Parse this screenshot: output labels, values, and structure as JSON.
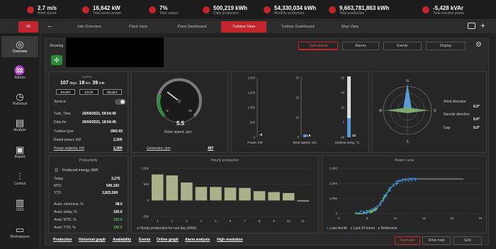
{
  "kpis": [
    {
      "value": "2.7 m/s",
      "label": "Wind speed"
    },
    {
      "value": "16,642 kW",
      "label": "Total active power"
    },
    {
      "value": "7%",
      "label": "Total output"
    },
    {
      "value": "500,219 kWh",
      "label": "Daily production"
    },
    {
      "value": "54,330,034 kWh",
      "label": "Monthly production"
    },
    {
      "value": "9,663,781,863 kWh",
      "label": "Total production"
    },
    {
      "value": "-5,428 kVAr",
      "label": "Total reactive power"
    }
  ],
  "nav": {
    "red_label": "3D",
    "tabs": [
      "Site Overview",
      "Plant View",
      "Plant Dashboard",
      "Turbine View",
      "Turbine Dashboard",
      "Map View"
    ],
    "active": "Turbine View"
  },
  "sidebar": [
    {
      "label": "Overview"
    },
    {
      "label": "Alarms"
    },
    {
      "label": "Historical"
    },
    {
      "label": "Analyze"
    },
    {
      "label": "Report"
    },
    {
      "label": "Control"
    },
    {
      "label": "CMS"
    },
    {
      "label": "Workspaces"
    }
  ],
  "header": {
    "showing": "Showing",
    "tabs": [
      "Operational",
      "Alarms",
      "Events",
      "Display"
    ]
  },
  "uptime": {
    "title": "Uptime",
    "days": "107",
    "days_u": "days",
    "hrs": "18",
    "hrs_u": "hrs",
    "min": "39",
    "min_u": "min",
    "buttons": [
      "START",
      "STOP",
      "RESET"
    ],
    "service": "Service"
  },
  "info": [
    {
      "label": "Turb. Time",
      "value": "20/04/2021, 09:54:45"
    },
    {
      "label": "Data for",
      "value": "20/04/2021, 18:54:45"
    },
    {
      "label": "Turbine type",
      "value": "2M3-93"
    },
    {
      "label": "Rated power, kW",
      "value": "2,300"
    },
    {
      "label": "Power setpoint, kW",
      "value": "2,300"
    }
  ],
  "rotor": {
    "value": "5.5",
    "label": "Rotor speed, rpm",
    "min": "0",
    "max": "20",
    "gen_label": "Generator, rpm",
    "gen_value": "497"
  },
  "bars": [
    {
      "label": "Power, kW",
      "value": "-9",
      "ticks": [
        "2,000",
        "1,500",
        "1,000",
        "500",
        "0"
      ]
    },
    {
      "label": "Wind speed, m/s",
      "value": "1.8",
      "ticks": [
        "30",
        "20",
        "10",
        "0"
      ]
    },
    {
      "label": "Outdoor temp, °C",
      "value": "12",
      "ticks": [
        "60",
        "40",
        "20",
        "0",
        "-20"
      ]
    }
  ],
  "compass": {
    "N": "N",
    "E": "E",
    "S": "S",
    "W": "W",
    "rows": [
      {
        "label": "Wind direction",
        "value": "0.0°"
      },
      {
        "label": "Nacelle direction",
        "value": "0.0°"
      },
      {
        "label": "Gap",
        "value": "0.0°"
      }
    ]
  },
  "productivity": {
    "title": "Productivity",
    "sub": "Produced energy, kWh",
    "rows": [
      {
        "label": "Today",
        "value": "3,275"
      },
      {
        "label": "MTD",
        "value": "545,193"
      },
      {
        "label": "YTD",
        "value": "3,822,599"
      }
    ],
    "avail": [
      {
        "label": "Avail. reference, %",
        "value": "98.0"
      },
      {
        "label": "Avail. today, %",
        "value": "100.0"
      },
      {
        "label": "Avail. MTD, %",
        "value": "100.0"
      },
      {
        "label": "Avail. YTD, %",
        "value": "100.0"
      }
    ]
  },
  "hourly": {
    "title": "Hourly production",
    "legend": "Hourly production for last day (kWh)"
  },
  "power_curve": {
    "title": "Power curve",
    "legend": [
      "Last month",
      "Last 24 hours",
      "Reference"
    ]
  },
  "links": [
    "Production",
    "Historical graph",
    "Availability",
    "Events",
    "Online graph",
    "Alarm analysis",
    "High resolution"
  ],
  "bottom_tabs": [
    "Overview",
    "Drive train",
    "Grid"
  ],
  "chart_data": [
    {
      "type": "bar",
      "title": "Hourly production",
      "categories": [
        "1",
        "2",
        "3",
        "4",
        "5",
        "6",
        "7",
        "8",
        "9",
        "10",
        "11"
      ],
      "values": [
        810,
        780,
        560,
        420,
        420,
        400,
        390,
        290,
        260,
        230,
        -30
      ],
      "ylim": [
        -500,
        1000
      ],
      "yticks": [
        "1,000",
        "500",
        "0",
        "-500"
      ],
      "series": [
        {
          "name": "Hourly production for last day (kWh)",
          "values": [
            810,
            780,
            560,
            420,
            420,
            400,
            390,
            290,
            260,
            230,
            -30
          ]
        }
      ]
    },
    {
      "type": "scatter",
      "title": "Power curve",
      "xlim": [
        0,
        25
      ],
      "ylim": [
        0,
        3000
      ],
      "xticks": [
        "0",
        "5",
        "10",
        "15",
        "20",
        "25"
      ],
      "yticks": [
        "3,000",
        "2,000",
        "1,000",
        "0"
      ],
      "series": [
        {
          "name": "Last month",
          "color": "#2e86de"
        },
        {
          "name": "Last 24 hours",
          "color": "#7bc043"
        },
        {
          "name": "Reference",
          "color": "#bbbbbb"
        }
      ]
    }
  ]
}
